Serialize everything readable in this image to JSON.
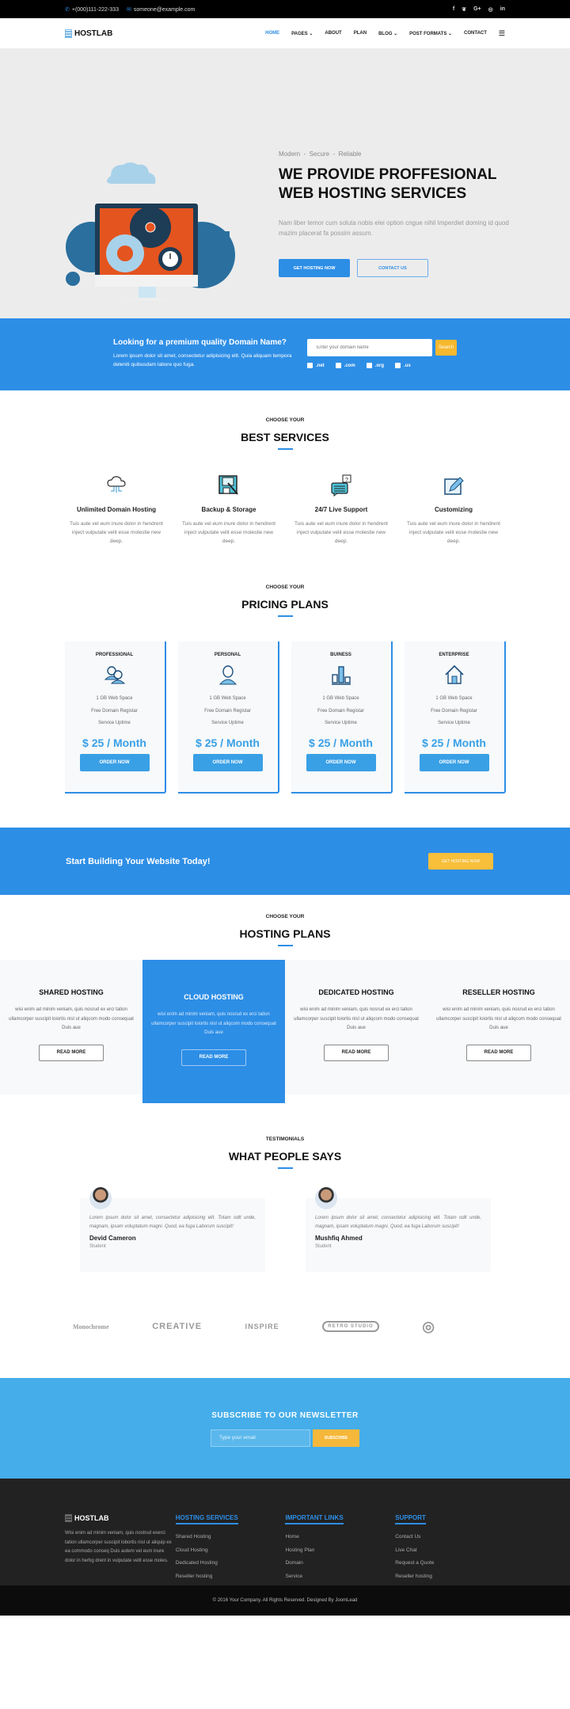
{
  "topbar": {
    "phone": "+(000)111-222-333",
    "email": "someone@example.com",
    "social": [
      "f",
      "♥",
      "G+",
      "◎",
      "in"
    ]
  },
  "nav": {
    "logo": "HOSTLAB",
    "items": [
      {
        "label": "HOME",
        "active": true
      },
      {
        "label": "PAGES ⌄"
      },
      {
        "label": "ABOUT"
      },
      {
        "label": "PLAN"
      },
      {
        "label": "BLOG ⌄"
      },
      {
        "label": "POST FORMATS ⌄"
      },
      {
        "label": "CONTACT"
      }
    ],
    "menu_icon": "☰"
  },
  "hero": {
    "tagline": "Modern  -  Secure  -  Reliable",
    "title": "WE PROVIDE PROFFESIONAL WEB HOSTING SERVICES",
    "text": "Nam liber temor cum soluta nobis elei option cngue nihil Imperdiet doming id quod mazim placerat fa possim assum.",
    "primary_btn": "GET HOSTING NOW",
    "secondary_btn": "CONTACT US"
  },
  "domain": {
    "title": "Looking for a premium quality Domain Name?",
    "text": "Lorem ipsum dolor sit amet, consectetur adipisicing elit. Quia aliquam tempora deleniti quibusdam labore quo fuga.",
    "placeholder": "Enter your domain name",
    "search_btn": "Search",
    "tlds": [
      ".net",
      ".com",
      ".org",
      ".us"
    ]
  },
  "services": {
    "kicker": "CHOOSE YOUR",
    "title": "BEST SERVICES",
    "items": [
      {
        "title": "Unlimited Domain Hosting",
        "text": "Tuis aute vel eum inure dolor in hendrent inject vulputate velit esse molestie new deep."
      },
      {
        "title": "Backup & Storage",
        "text": "Tuis aute vel eum inure dolor in hendrent inject vulputate velit esse molestie new deep."
      },
      {
        "title": "24/7 Live Support",
        "text": "Tuis aute vel eum inure dolor in hendrent inject vulputate velit esse molestie new deep."
      },
      {
        "title": "Customizing",
        "text": "Tuis aute vel eum inure dolor in hendrent inject vulputate velit esse molestie new deep."
      }
    ]
  },
  "pricing": {
    "kicker": "CHOOSE YOUR",
    "title": "PRICING PLANS",
    "plans": [
      {
        "name": "PROFESSIONAL",
        "features": [
          "1 GB Web Space",
          "Free Domain Registar",
          "Service Uptime"
        ],
        "price": "$ 25 / Month",
        "button": "ORDER NOW"
      },
      {
        "name": "PERSONAL",
        "features": [
          "1 GB Web Space",
          "Free Domain Registar",
          "Service Uptime"
        ],
        "price": "$ 25 / Month",
        "button": "ORDER NOW"
      },
      {
        "name": "BUINESS",
        "features": [
          "1 GB Web Space",
          "Free Domain Registar",
          "Service Uptime"
        ],
        "price": "$ 25 / Month",
        "button": "ORDER NOW"
      },
      {
        "name": "ENTERPRISE",
        "features": [
          "1 GB Web Space",
          "Free Domain Registar",
          "Service Uptime"
        ],
        "price": "$ 25 / Month",
        "button": "ORDER NOW"
      }
    ]
  },
  "cta": {
    "title": "Start Building Your Website Today!",
    "button": "GET HOSTING NOW"
  },
  "hosting": {
    "kicker": "CHOOSE YOUR",
    "title": "HOSTING PLANS",
    "plans": [
      {
        "name": "SHARED HOSTING",
        "text": "wisi enim ad minim veniam, quis nosrud ex erci tation ullamcorper suscipit loiortis nisl ut aliqcom modo consequat Duis aue",
        "button": "READ MORE"
      },
      {
        "name": "CLOUD HOSTING",
        "text": "wisi enim ad minim veniam, quis nosrud ex erci tation ullamcorper suscipit loiortis nisl ut aliqcom modo consequat Duis aue",
        "button": "READ MORE"
      },
      {
        "name": "DEDICATED HOSTING",
        "text": "wisi enim ad minim veniam, quis nosrud ex erci tation ullamcorper suscipit loiortis nisl ut aliqcom modo consequat Duis aue",
        "button": "READ MORE"
      },
      {
        "name": "RESELLER HOSTING",
        "text": "wisi enim ad minim veniam, quis nosrud ex erci tation ullamcorper suscipit loiortis nisl ut aliqcom modo consequat Duis aue",
        "button": "READ MORE"
      }
    ]
  },
  "testimonials": {
    "kicker": "TESTIMONIALS",
    "title": "WHAT PEOPLE SAYS",
    "items": [
      {
        "quote": "Lorem ipsum dolor sit amet, consectetur adipisicing elit. Totam odit unde, magnam, ipsam voluptatum magni. Quod, ea fuga Laborum suscipit!",
        "name": "Devid Cameron",
        "role": "Student"
      },
      {
        "quote": "Lorem ipsum dolor sit amet, consectetur adipisicing elit. Totam odit unde, magnam, ipsam voluptatum magni. Quod, ea fuga Laborum suscipit!",
        "name": "Mushfiq Ahmed",
        "role": "Student"
      }
    ]
  },
  "brands": [
    "Monochrome",
    "CREATIVE",
    "INSPIRE",
    "RETRO STUDIO",
    "◎"
  ],
  "newsletter": {
    "title": "SUBSCRIBE TO OUR NEWSLETTER",
    "placeholder": "Type your email",
    "button": "SUBSCRIBE"
  },
  "footer": {
    "logo": "HOSTLAB",
    "about": "Wisi enim ad minim veniam, quis nostrud exerci tation ullamcorper suscipit lobortis nisl ut aliquip ex ea commodo conseq Duis autem vel eum inure dolor in herbg drent in vulputate velit esse moles.",
    "columns": [
      {
        "title": "HOSTING SERVICES",
        "links": [
          "Shared Hosting",
          "Cloud Hosting",
          "Dedicated Hosting",
          "Reseller hosting"
        ]
      },
      {
        "title": "IMPORTANT LINKS",
        "links": [
          "Home",
          "Hosting Plan",
          "Domain",
          "Service"
        ]
      },
      {
        "title": "SUPPORT",
        "links": [
          "Contact Us",
          "Live Chat",
          "Request a Quote",
          "Reseller hosting"
        ]
      }
    ],
    "copyright": "© 2016 Your Company. All Rights Reserved. Designed By JoomLead"
  }
}
